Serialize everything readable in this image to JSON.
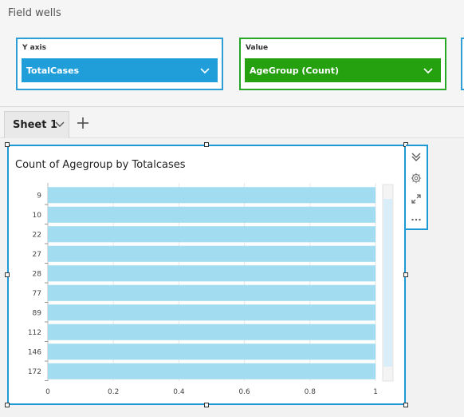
{
  "field_wells": {
    "title": "Field wells",
    "y_axis": {
      "label": "Y axis",
      "value": "TotalCases"
    },
    "value": {
      "label": "Value",
      "value": "AgeGroup (Count)"
    }
  },
  "sheets": {
    "tabs": [
      {
        "label": "Sheet 1"
      }
    ]
  },
  "visual": {
    "title": "Count of Agegroup by Totalcases"
  },
  "colors": {
    "bar": "#a2dcf0",
    "accent": "#1d9ad6",
    "green": "#25a10f"
  },
  "icons": [
    "chevron-down-icon",
    "plus-icon",
    "collapse-icon",
    "gear-icon",
    "expand-icon",
    "more-icon"
  ],
  "chart_data": {
    "type": "bar",
    "orientation": "horizontal",
    "title": "Count of Agegroup by Totalcases",
    "categories": [
      "9",
      "10",
      "22",
      "27",
      "28",
      "77",
      "89",
      "112",
      "146",
      "172"
    ],
    "values": [
      1,
      1,
      1,
      1,
      1,
      1,
      1,
      1,
      1,
      1
    ],
    "xlim": [
      0,
      1
    ],
    "xticks": [
      "0",
      "0.2",
      "0.4",
      "0.6",
      "0.8",
      "1"
    ],
    "grid": true,
    "legend": "none"
  }
}
